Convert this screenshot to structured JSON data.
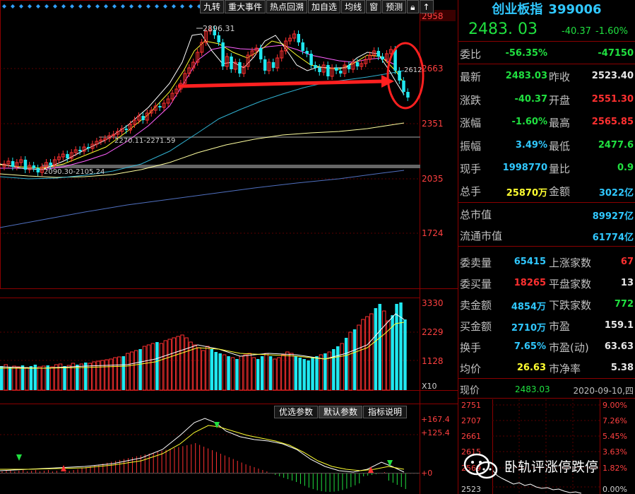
{
  "toolbar": {
    "buttons": [
      "九转",
      "重大事件",
      "热点回溯",
      "加自选",
      "均线",
      "窗",
      "预测"
    ]
  },
  "price_axis": {
    "labels": [
      "2958",
      "2663",
      "2351",
      "2035",
      "1724"
    ]
  },
  "kline_annotations": {
    "high": "2896.31",
    "gap_upper": "2270.11-2271.59",
    "gap_lower": "2090.30-2105.24",
    "ma_value": "2612"
  },
  "volume_axis": {
    "labels": [
      "3330",
      "2229",
      "1128",
      "X10"
    ]
  },
  "indicator_tabs": [
    "优选参数",
    "默认参数",
    "指标说明"
  ],
  "indicator_axis": {
    "labels": [
      "+167.4",
      "+125.4",
      "+0"
    ]
  },
  "panel": {
    "name": "创业板指",
    "code": "399006",
    "price": "2483. 03",
    "change": "-40.37",
    "change_pct": "-1.60%",
    "weibi": {
      "label": "委比",
      "v1": "-56.35%",
      "v2": "-47150"
    },
    "quote_rows": [
      {
        "l1": "最新",
        "v1": "2483.03",
        "l2": "昨收",
        "v2": "2523.40"
      },
      {
        "l1": "涨跌",
        "v1": "-40.37",
        "l2": "开盘",
        "v2": "2551.30"
      },
      {
        "l1": "涨幅",
        "v1": "-1.60%",
        "l2": "最高",
        "v2": "2565.85"
      },
      {
        "l1": "振幅",
        "v1": "3.49%",
        "l2": "最低",
        "v2": "2477.6"
      },
      {
        "l1": "现手",
        "v1": "1998770",
        "l2": "量比",
        "v2": "0.9"
      },
      {
        "l1": "总手",
        "v1": "25870万",
        "l2": "金额",
        "v2": "3022亿"
      }
    ],
    "cap_rows": [
      {
        "l1": "总市值",
        "v1": "89927亿"
      },
      {
        "l1": "流通市值",
        "v1": "61774亿"
      }
    ],
    "market_rows": [
      {
        "l1": "委卖量",
        "v1": "65415",
        "l2": "上涨家数",
        "v2": "67"
      },
      {
        "l1": "委买量",
        "v1": "18265",
        "l2": "平盘家数",
        "v2": "13"
      },
      {
        "l1": "卖金额",
        "v1": "4854万",
        "l2": "下跌家数",
        "v2": "772"
      },
      {
        "l1": "买金额",
        "v1": "2710万",
        "l2": "市盈",
        "v2": "159.1"
      },
      {
        "l1": "换手",
        "v1": "7.65%",
        "l2": "市盈(动)",
        "v2": "63.63"
      },
      {
        "l1": "均价",
        "v1": "26.63",
        "l2": "市净率",
        "v2": "5.38"
      }
    ],
    "now": {
      "label": "现价",
      "value": "2483.03",
      "date": "2020-09-10,四"
    },
    "mini_left": [
      "2751",
      "2707",
      "2661",
      "2615",
      "2569",
      "2523"
    ],
    "mini_right": [
      "9.00%",
      "7.26%",
      "5.45%",
      "3.63%",
      "1.82%",
      "0.00%"
    ]
  },
  "watermark": {
    "text": "卧轨评涨停跌停"
  },
  "colors": {
    "up": "#ff3030",
    "down": "#20e8f0",
    "ma5": "#ffffff",
    "ma10": "#ffff30",
    "ma20": "#ff60ff",
    "ma60": "#30b0d0",
    "ma120": "#ffffa0",
    "ma250": "#5070c0",
    "arrow": "#ff2020"
  }
}
